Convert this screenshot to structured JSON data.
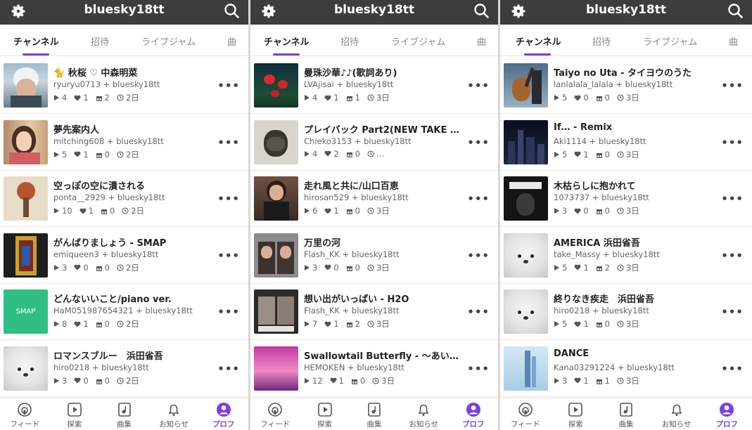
{
  "brand_color": "#7b3fe4",
  "panels": [
    {
      "header": {
        "title": "bluesky18tt"
      },
      "tabs": [
        "チャンネル",
        "招待",
        "ライブジャム",
        "曲"
      ],
      "items": [
        {
          "title": "🐈 秋桜 ♡ 中森明菜",
          "sub": "ryuryu0713 + bluesky18tt",
          "plays": "4",
          "likes": "1",
          "gifts": "2",
          "time": "2日",
          "thumb": "t-boy"
        },
        {
          "title": "夢先案内人",
          "sub": "mitching608 + bluesky18tt",
          "plays": "5",
          "likes": "1",
          "gifts": "0",
          "time": "2日",
          "thumb": "t-singer"
        },
        {
          "title": "空っぽの空に潰される",
          "sub": "ponta__2929 + bluesky18tt",
          "plays": "10",
          "likes": "1",
          "gifts": "0",
          "time": "2日",
          "thumb": "t-album"
        },
        {
          "title": "がんばりましょう - SMAP",
          "sub": "emiqueen3 + bluesky18tt",
          "plays": "3",
          "likes": "0",
          "gifts": "0",
          "time": "2日",
          "thumb": "t-smapbox"
        },
        {
          "title": "どんないいこと/piano ver.",
          "sub": "HaM051987654321 + bluesky18tt",
          "plays": "8",
          "likes": "1",
          "gifts": "0",
          "time": "2日",
          "thumb": "t-smap"
        },
        {
          "title": "ロマンスブルー　浜田省吾",
          "sub": "hiro0218 + bluesky18tt",
          "plays": "3",
          "likes": "0",
          "gifts": "0",
          "time": "2日",
          "thumb": "t-seal"
        }
      ]
    },
    {
      "header": {
        "title": "bluesky18tt"
      },
      "tabs": [
        "チャンネル",
        "招待",
        "ライブジャム",
        "曲"
      ],
      "items": [
        {
          "title": "曼珠沙華♪♪(歌詞あり)",
          "sub": "LVAjisai + bluesky18tt",
          "plays": "4",
          "likes": "1",
          "gifts": "1",
          "time": "3日",
          "thumb": "t-flower"
        },
        {
          "title": "プレイバック Part2(NEW TAKE 原…",
          "sub": "Chieko3153 + bluesky18tt",
          "plays": "4",
          "likes": "2",
          "gifts": "0",
          "time": "…",
          "thumb": "t-mask"
        },
        {
          "title": "走れ風と共に/山口百恵",
          "sub": "hirosan529 + bluesky18tt",
          "plays": "6",
          "likes": "1",
          "gifts": "0",
          "time": "3日",
          "thumb": "t-momoe"
        },
        {
          "title": "万里の河",
          "sub": "Flash_KK + bluesky18tt",
          "plays": "3",
          "likes": "0",
          "gifts": "0",
          "time": "3日",
          "thumb": "t-duo"
        },
        {
          "title": "想い出がいっぱい - H2O",
          "sub": "Flash_KK + bluesky18tt",
          "plays": "7",
          "likes": "1",
          "gifts": "2",
          "time": "3日",
          "thumb": "t-h2o"
        },
        {
          "title": "Swallowtail Butterfly - ～あいのう…",
          "sub": "HEMOKEN + bluesky18tt",
          "plays": "12",
          "likes": "1",
          "gifts": "0",
          "time": "3日",
          "thumb": "t-pink"
        }
      ]
    },
    {
      "header": {
        "title": "bluesky18tt"
      },
      "tabs": [
        "チャンネル",
        "招待",
        "ライブジャム",
        "曲"
      ],
      "items": [
        {
          "title": "Taiyo no Uta - タイヨウのうた",
          "sub": "lanlalala_lalala + bluesky18tt",
          "plays": "5",
          "likes": "0",
          "gifts": "0",
          "time": "3日",
          "thumb": "t-guitar"
        },
        {
          "title": "If… - Remix",
          "sub": "Aki1114 + bluesky18tt",
          "plays": "5",
          "likes": "1",
          "gifts": "0",
          "time": "3日",
          "thumb": "t-city"
        },
        {
          "title": "木枯らしに抱かれて",
          "sub": "1073737 + bluesky18tt",
          "plays": "3",
          "likes": "0",
          "gifts": "0",
          "time": "3日",
          "thumb": "t-kogarashi"
        },
        {
          "title": "AMERICA 浜田省吾",
          "sub": "take_Massy + bluesky18tt",
          "plays": "5",
          "likes": "1",
          "gifts": "2",
          "time": "3日",
          "thumb": "t-seal"
        },
        {
          "title": "終りなき疾走　浜田省吾",
          "sub": "hiro0218 + bluesky18tt",
          "plays": "5",
          "likes": "1",
          "gifts": "0",
          "time": "3日",
          "thumb": "t-seal"
        },
        {
          "title": "DANCE",
          "sub": "Kana03291224 + bluesky18tt",
          "plays": "3",
          "likes": "1",
          "gifts": "1",
          "time": "3日",
          "thumb": "t-dance"
        }
      ]
    }
  ],
  "nav": [
    "フィード",
    "探索",
    "曲集",
    "お知らせ",
    "プロフ"
  ],
  "thumb_texts": {
    "smap": "SMAP"
  },
  "icons": {
    "header_left": "gear-icon",
    "header_right": "search-icon",
    "more": "more-icon",
    "play": "play-icon",
    "like": "heart-icon",
    "gift": "gift-icon",
    "time": "clock-icon"
  }
}
